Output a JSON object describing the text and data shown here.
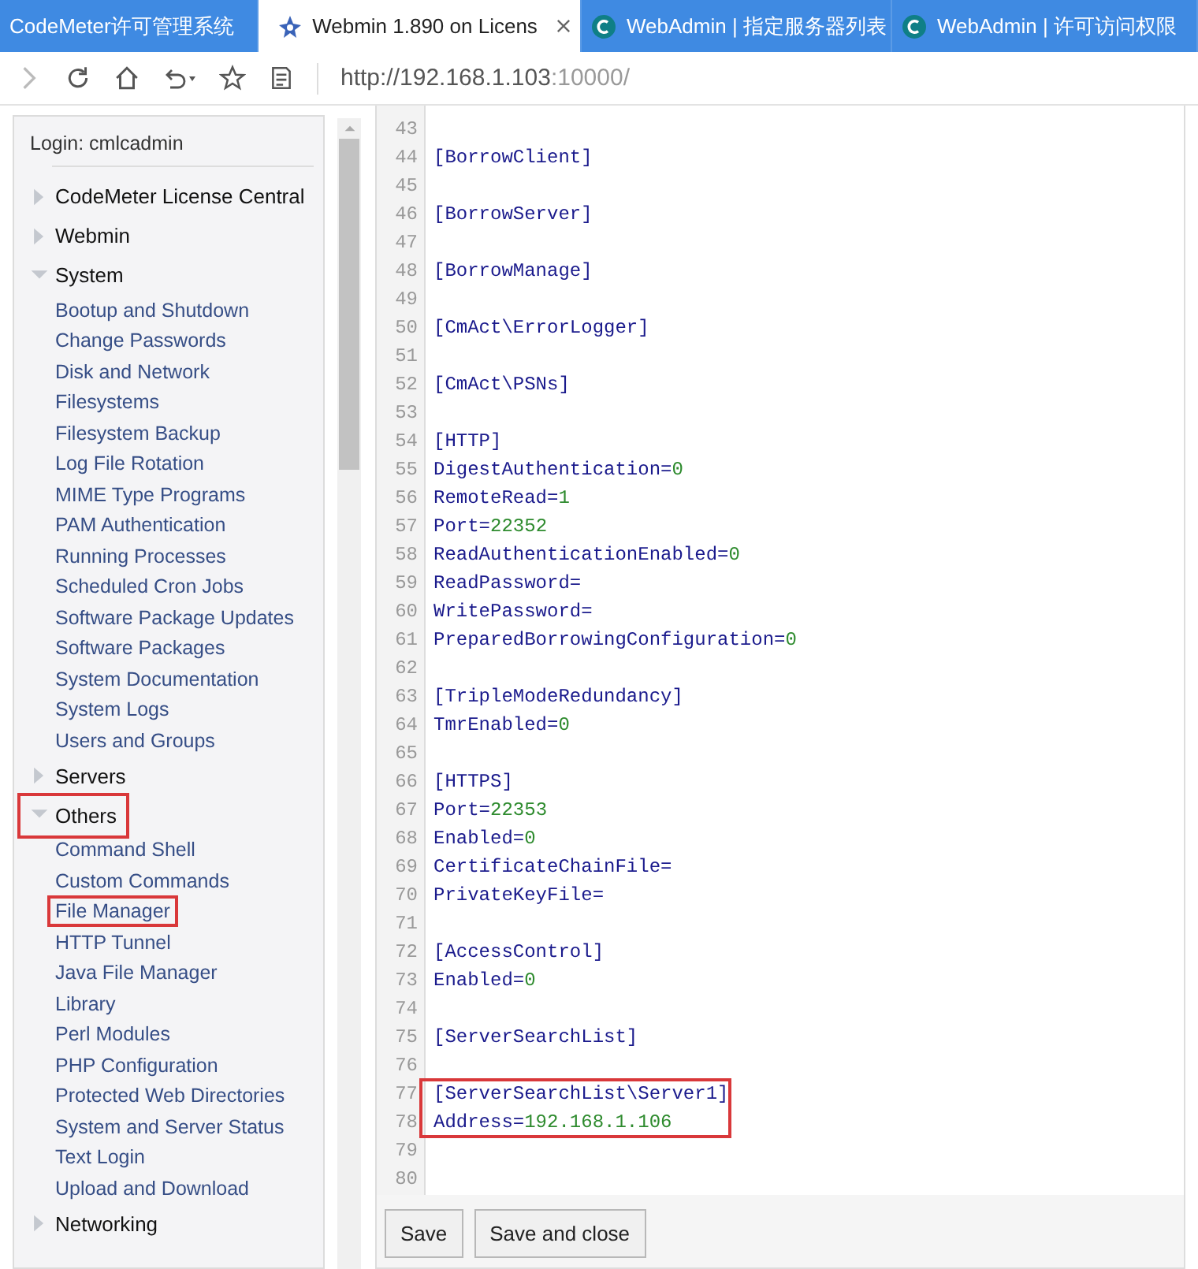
{
  "tabs": [
    {
      "title": "CodeMeter许可管理系统",
      "selected": false
    },
    {
      "title": "Webmin 1.890 on Licens",
      "selected": true
    },
    {
      "title": "WebAdmin | 指定服务器列表",
      "selected": false
    },
    {
      "title": "WebAdmin | 许可访问权限",
      "selected": false
    }
  ],
  "address_bar": {
    "host": "http://192.168.1.103",
    "port": ":10000/"
  },
  "sidebar": {
    "login": "Login: cmlcadmin",
    "categories": [
      {
        "label": "CodeMeter License Central",
        "expanded": false,
        "annotated": false
      },
      {
        "label": "Webmin",
        "expanded": false,
        "annotated": false
      },
      {
        "label": "System",
        "expanded": true,
        "annotated": false,
        "items": [
          {
            "label": "Bootup and Shutdown",
            "annotated": false
          },
          {
            "label": "Change Passwords",
            "annotated": false
          },
          {
            "label": "Disk and Network",
            "annotated": false
          },
          {
            "label": "Filesystems",
            "annotated": false
          },
          {
            "label": "Filesystem Backup",
            "annotated": false
          },
          {
            "label": "Log File Rotation",
            "annotated": false
          },
          {
            "label": "MIME Type Programs",
            "annotated": false
          },
          {
            "label": "PAM Authentication",
            "annotated": false
          },
          {
            "label": "Running Processes",
            "annotated": false
          },
          {
            "label": "Scheduled Cron Jobs",
            "annotated": false
          },
          {
            "label": "Software Package Updates",
            "annotated": false
          },
          {
            "label": "Software Packages",
            "annotated": false
          },
          {
            "label": "System Documentation",
            "annotated": false
          },
          {
            "label": "System Logs",
            "annotated": false
          },
          {
            "label": "Users and Groups",
            "annotated": false
          }
        ]
      },
      {
        "label": "Servers",
        "expanded": false,
        "annotated": false
      },
      {
        "label": "Others",
        "expanded": true,
        "annotated": true,
        "items": [
          {
            "label": "Command Shell",
            "annotated": false
          },
          {
            "label": "Custom Commands",
            "annotated": false
          },
          {
            "label": "File Manager",
            "annotated": true
          },
          {
            "label": "HTTP Tunnel",
            "annotated": false
          },
          {
            "label": "Java File Manager",
            "annotated": false
          },
          {
            "label": "Library",
            "annotated": false
          },
          {
            "label": "Perl Modules",
            "annotated": false
          },
          {
            "label": "PHP Configuration",
            "annotated": false
          },
          {
            "label": "Protected Web Directories",
            "annotated": false
          },
          {
            "label": "System and Server Status",
            "annotated": false
          },
          {
            "label": "Text Login",
            "annotated": false
          },
          {
            "label": "Upload and Download",
            "annotated": false
          }
        ]
      },
      {
        "label": "Networking",
        "expanded": false,
        "annotated": false
      }
    ]
  },
  "editor": {
    "lines": [
      {
        "number": "43",
        "kind": "blank",
        "annotated": false
      },
      {
        "number": "44",
        "kind": "section",
        "text": "[BorrowClient]",
        "annotated": false
      },
      {
        "number": "45",
        "kind": "blank",
        "annotated": false
      },
      {
        "number": "46",
        "kind": "section",
        "text": "[BorrowServer]",
        "annotated": false
      },
      {
        "number": "47",
        "kind": "blank",
        "annotated": false
      },
      {
        "number": "48",
        "kind": "section",
        "text": "[BorrowManage]",
        "annotated": false
      },
      {
        "number": "49",
        "kind": "blank",
        "annotated": false
      },
      {
        "number": "50",
        "kind": "section",
        "text": "[CmAct\\ErrorLogger]",
        "annotated": false
      },
      {
        "number": "51",
        "kind": "blank",
        "annotated": false
      },
      {
        "number": "52",
        "kind": "section",
        "text": "[CmAct\\PSNs]",
        "annotated": false
      },
      {
        "number": "53",
        "kind": "blank",
        "annotated": false
      },
      {
        "number": "54",
        "kind": "section",
        "text": "[HTTP]",
        "annotated": false
      },
      {
        "number": "55",
        "kind": "pair",
        "key": "DigestAuthentication=",
        "value": "0",
        "annotated": false
      },
      {
        "number": "56",
        "kind": "pair",
        "key": "RemoteRead=",
        "value": "1",
        "annotated": false
      },
      {
        "number": "57",
        "kind": "pair",
        "key": "Port=",
        "value": "22352",
        "annotated": false
      },
      {
        "number": "58",
        "kind": "pair",
        "key": "ReadAuthenticationEnabled=",
        "value": "0",
        "annotated": false
      },
      {
        "number": "59",
        "kind": "pair",
        "key": "ReadPassword=",
        "annotated": false
      },
      {
        "number": "60",
        "kind": "pair",
        "key": "WritePassword=",
        "annotated": false
      },
      {
        "number": "61",
        "kind": "pair",
        "key": "PreparedBorrowingConfiguration=",
        "value": "0",
        "annotated": false
      },
      {
        "number": "62",
        "kind": "blank",
        "annotated": false
      },
      {
        "number": "63",
        "kind": "section",
        "text": "[TripleModeRedundancy]",
        "annotated": false
      },
      {
        "number": "64",
        "kind": "pair",
        "key": "TmrEnabled=",
        "value": "0",
        "annotated": false
      },
      {
        "number": "65",
        "kind": "blank",
        "annotated": false
      },
      {
        "number": "66",
        "kind": "section",
        "text": "[HTTPS]",
        "annotated": false
      },
      {
        "number": "67",
        "kind": "pair",
        "key": "Port=",
        "value": "22353",
        "annotated": false
      },
      {
        "number": "68",
        "kind": "pair",
        "key": "Enabled=",
        "value": "0",
        "annotated": false
      },
      {
        "number": "69",
        "kind": "pair",
        "key": "CertificateChainFile=",
        "annotated": false
      },
      {
        "number": "70",
        "kind": "pair",
        "key": "PrivateKeyFile=",
        "annotated": false
      },
      {
        "number": "71",
        "kind": "blank",
        "annotated": false
      },
      {
        "number": "72",
        "kind": "section",
        "text": "[AccessControl]",
        "annotated": false
      },
      {
        "number": "73",
        "kind": "pair",
        "key": "Enabled=",
        "value": "0",
        "annotated": false
      },
      {
        "number": "74",
        "kind": "blank",
        "annotated": false
      },
      {
        "number": "75",
        "kind": "section",
        "text": "[ServerSearchList]",
        "annotated": false
      },
      {
        "number": "76",
        "kind": "blank",
        "annotated": false
      },
      {
        "number": "77",
        "kind": "section",
        "text": "[ServerSearchList\\Server1]",
        "annotated": true
      },
      {
        "number": "78",
        "kind": "pair",
        "key": "Address=",
        "value": "192.168.1.106",
        "annotated": true
      },
      {
        "number": "79",
        "kind": "blank",
        "annotated": false
      },
      {
        "number": "80",
        "kind": "blank",
        "annotated": false
      }
    ]
  },
  "buttons": [
    "Save",
    "Save and close"
  ]
}
